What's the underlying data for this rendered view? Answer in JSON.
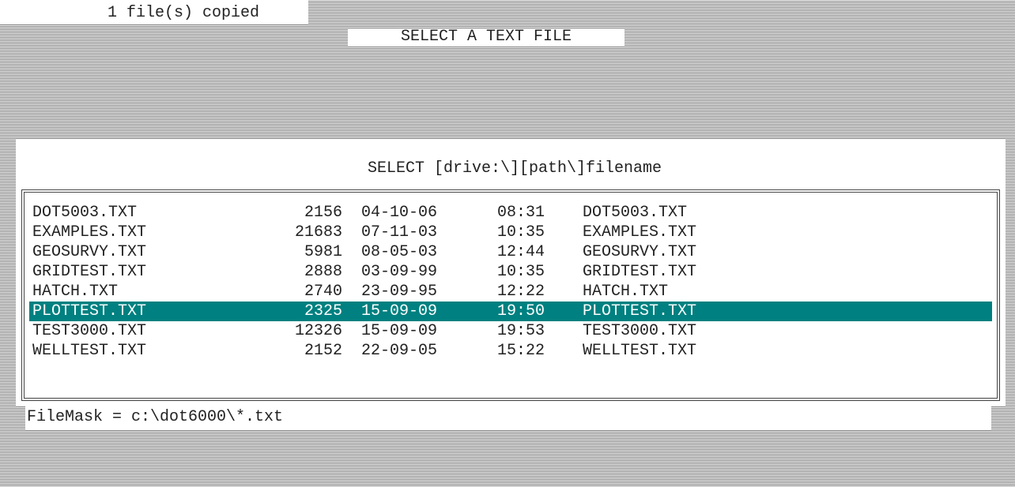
{
  "status": {
    "message": "1 file(s) copied"
  },
  "dialog": {
    "title": "SELECT A TEXT FILE",
    "prompt": "SELECT [drive:\\][path\\]filename",
    "selected_file": "PLOTTEST.TXT",
    "files": [
      {
        "name": "DOT5003.TXT",
        "size": "2156",
        "date": "04-10-06",
        "time": "08:31",
        "long_name": "DOT5003.TXT",
        "selected": false
      },
      {
        "name": "EXAMPLES.TXT",
        "size": "21683",
        "date": "07-11-03",
        "time": "10:35",
        "long_name": "EXAMPLES.TXT",
        "selected": false
      },
      {
        "name": "GEOSURVY.TXT",
        "size": "5981",
        "date": "08-05-03",
        "time": "12:44",
        "long_name": "GEOSURVY.TXT",
        "selected": false
      },
      {
        "name": "GRIDTEST.TXT",
        "size": "2888",
        "date": "03-09-99",
        "time": "10:35",
        "long_name": "GRIDTEST.TXT",
        "selected": false
      },
      {
        "name": "HATCH.TXT",
        "size": "2740",
        "date": "23-09-95",
        "time": "12:22",
        "long_name": "HATCH.TXT",
        "selected": false
      },
      {
        "name": "PLOTTEST.TXT",
        "size": "2325",
        "date": "15-09-09",
        "time": "19:50",
        "long_name": "PLOTTEST.TXT",
        "selected": true
      },
      {
        "name": "TEST3000.TXT",
        "size": "12326",
        "date": "15-09-09",
        "time": "19:53",
        "long_name": "TEST3000.TXT",
        "selected": false
      },
      {
        "name": "WELLTEST.TXT",
        "size": "2152",
        "date": "22-09-05",
        "time": "15:22",
        "long_name": "WELLTEST.TXT",
        "selected": false
      }
    ],
    "filemask": "FileMask = c:\\dot6000\\*.txt"
  },
  "colors": {
    "selection_background": "#008080",
    "selection_text": "#ffffff",
    "text": "#222222",
    "dither": "#7a7a7a",
    "background": "#ffffff"
  }
}
